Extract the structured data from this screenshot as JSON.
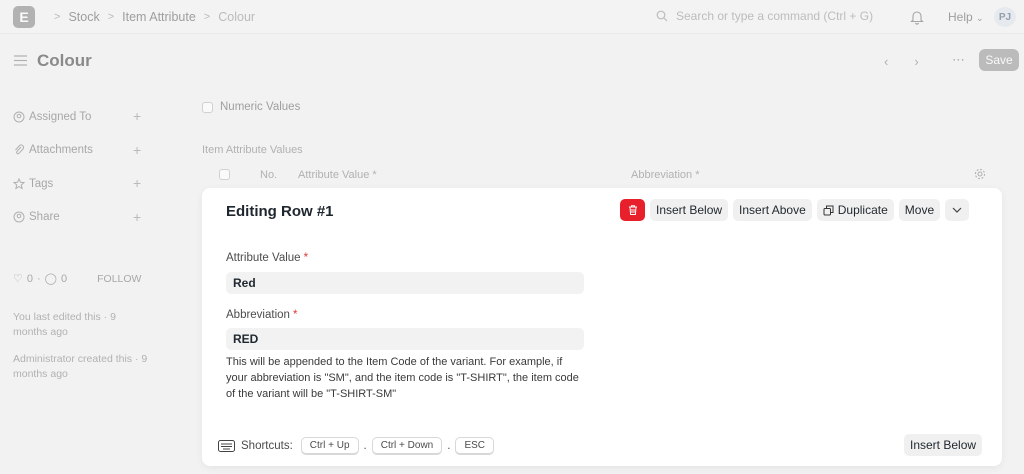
{
  "navbar": {
    "logo_letter": "E",
    "breadcrumbs": [
      "Stock",
      "Item Attribute",
      "Colour"
    ],
    "search_placeholder": "Search or type a command (Ctrl + G)",
    "help_label": "Help",
    "avatar_initials": "PJ"
  },
  "page": {
    "title": "Colour",
    "save_label": "Save"
  },
  "sidebar": {
    "items": [
      {
        "label": "Assigned To"
      },
      {
        "label": "Attachments"
      },
      {
        "label": "Tags"
      },
      {
        "label": "Share"
      }
    ],
    "likes_count": "0",
    "comments_count": "0",
    "follow_label": "FOLLOW",
    "last_edited": "You last edited this · 9 months ago",
    "created": "Administrator created this · 9 months ago"
  },
  "form": {
    "numeric_values_label": "Numeric Values",
    "values_section_title": "Item Attribute Values",
    "columns": [
      "No.",
      "Attribute Value *",
      "Abbreviation *"
    ]
  },
  "editing_panel": {
    "title": "Editing Row #1",
    "buttons": {
      "insert_below": "Insert Below",
      "insert_above": "Insert Above",
      "duplicate": "Duplicate",
      "move": "Move"
    },
    "fields": {
      "attribute_value_label": "Attribute Value",
      "attribute_value": "Red",
      "abbreviation_label": "Abbreviation",
      "abbreviation": "RED",
      "abbreviation_description": "This will be appended to the Item Code of the variant. For example, if your abbreviation is \"SM\", and the item code is \"T-SHIRT\", the item code of the variant will be \"T-SHIRT-SM\""
    },
    "shortcuts_label": "Shortcuts:",
    "shortcuts": [
      "Ctrl + Up",
      "Ctrl + Down",
      "ESC"
    ],
    "footer_insert_below": "Insert Below"
  },
  "colors": {
    "delete_button": "#e7202b",
    "required_mark": "#e03636"
  }
}
